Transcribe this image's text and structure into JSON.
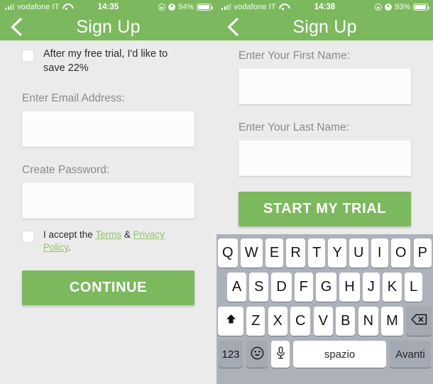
{
  "left_screen": {
    "status_bar": {
      "carrier": "vodafone IT",
      "time": "14:35",
      "battery": "94%",
      "signal_icon": "signal-bars-icon",
      "wifi_icon": "wifi-icon",
      "location_icon": "location-arrow-icon",
      "alarm_icon": "alarm-clock-icon",
      "battery_icon": "battery-icon"
    },
    "nav": {
      "back_icon": "chevron-left-icon",
      "title": "Sign Up"
    },
    "trial_checkbox": {
      "label": "After my free trial, I'd like to save 22%",
      "checked": false
    },
    "email": {
      "label": "Enter Email Address:",
      "value": "",
      "placeholder": ""
    },
    "password": {
      "label": "Create Password:",
      "value": "",
      "placeholder": ""
    },
    "terms_checkbox": {
      "prefix": "I accept the ",
      "terms_link": "Terms",
      "separator": " & ",
      "privacy_link": "Privacy Policy",
      "suffix": ".",
      "checked": false
    },
    "continue_button": "CONTINUE"
  },
  "right_screen": {
    "status_bar": {
      "carrier": "vodafone IT",
      "time": "14:38",
      "battery": "93%",
      "signal_icon": "signal-bars-icon",
      "wifi_icon": "wifi-icon",
      "location_icon": "location-arrow-icon",
      "alarm_icon": "alarm-clock-icon",
      "battery_icon": "battery-icon"
    },
    "nav": {
      "back_icon": "chevron-left-icon",
      "title": "Sign Up"
    },
    "first_name": {
      "label": "Enter Your First Name:",
      "value": "",
      "placeholder": ""
    },
    "last_name": {
      "label": "Enter Your Last Name:",
      "value": "",
      "placeholder": ""
    },
    "start_trial_button": "START MY TRIAL",
    "keyboard": {
      "row1": [
        "Q",
        "W",
        "E",
        "R",
        "T",
        "Y",
        "U",
        "I",
        "O",
        "P"
      ],
      "row2": [
        "A",
        "S",
        "D",
        "F",
        "G",
        "H",
        "J",
        "K",
        "L"
      ],
      "row3": [
        "Z",
        "X",
        "C",
        "V",
        "B",
        "N",
        "M"
      ],
      "shift_icon": "shift-up-arrow-icon",
      "delete_icon": "backspace-delete-icon",
      "numbers_key": "123",
      "emoji_icon": "smiley-face-icon",
      "mic_icon": "microphone-icon",
      "space_key": "spazio",
      "return_key": "Avanti"
    }
  },
  "colors": {
    "brand_green": "#7cb95e",
    "link_green": "#90c36b",
    "page_background": "#ebebeb",
    "keyboard_background": "#adb2ba",
    "key_white": "#ffffff",
    "key_dark": "#a4aab3",
    "label_gray": "#8a8a8a"
  }
}
